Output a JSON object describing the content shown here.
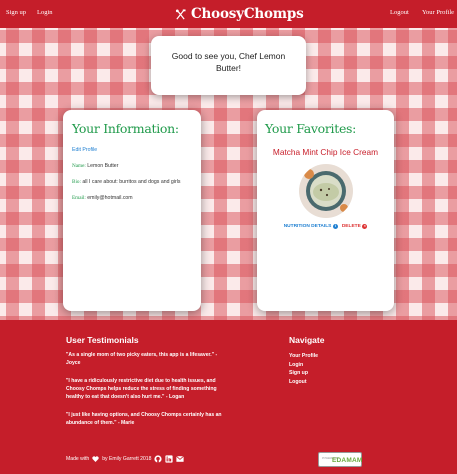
{
  "navbar": {
    "signup": "Sign up",
    "login": "Login",
    "brand": "ChoosyChomps",
    "logout": "Logout",
    "profile": "Your Profile"
  },
  "greeting": "Good to see you, Chef Lemon Butter!",
  "info": {
    "title": "Your Information:",
    "edit": "Edit Profile",
    "name_key": "Name:",
    "name_val": "Lemon Butter",
    "bio_key": "Bio:",
    "bio_val": "all I care about: burritos and dogs and girls",
    "email_key": "Email:",
    "email_val": "emily@hotmail.com"
  },
  "favorites": {
    "title": "Your Favorites:",
    "items": [
      {
        "name": "Matcha Mint Chip Ice Cream",
        "nutrition": "NUTRITION DETAILS",
        "delete": "DELETE"
      }
    ]
  },
  "footer": {
    "testimonials_heading": "User Testimonials",
    "testimonials": [
      "\"As a single mom of two picky eaters, this app is a lifesaver.\" - Joyce",
      "\"I have a ridiculously restrictive diet due to health issues, and Choosy Chomps helps reduce the stress of finding something healthy to eat that doesn't also hurt me.\" - Logan",
      "\"I just like having options, and Choosy Chomps certainly has an abundance of them.\" - Marie"
    ],
    "navigate_heading": "Navigate",
    "navigate_links": [
      "Your Profile",
      "Login",
      "Sign up",
      "Logout"
    ],
    "made_with_prefix": "Made with",
    "made_with_suffix": "by Emily Garrett 2018",
    "edamam_small": "POWERED BY",
    "edamam_big": "EDAMAM"
  },
  "colors": {
    "red": "#c51e2a",
    "green_title": "#1f9a4a",
    "link_blue": "#1e7fd1"
  },
  "icons": [
    "cutlery-icon",
    "info-icon",
    "delete-icon",
    "heart-icon",
    "github-icon",
    "linkedin-icon",
    "mail-icon"
  ]
}
